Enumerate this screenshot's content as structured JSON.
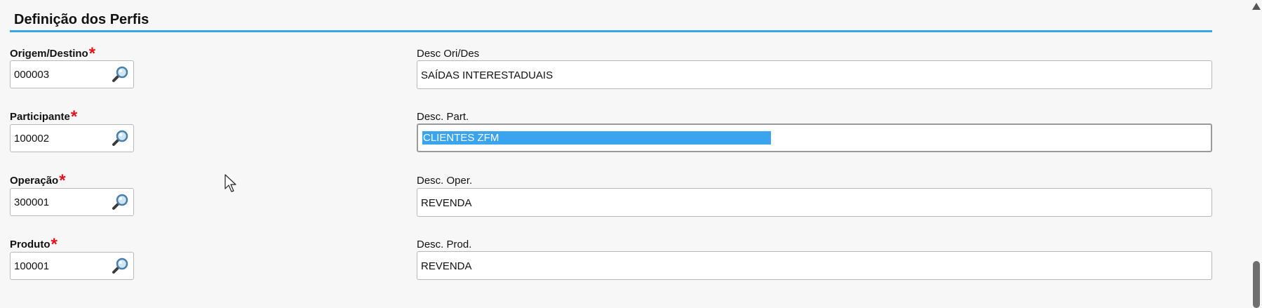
{
  "section": {
    "title": "Definição dos Perfis"
  },
  "required_marker": "*",
  "fields": [
    {
      "code_label": "Origem/Destino",
      "code_value": "000003",
      "desc_label": "Desc Ori/Des",
      "desc_value": "SAÍDAS INTERESTADUAIS"
    },
    {
      "code_label": "Participante",
      "code_value": "100002",
      "desc_label": "Desc. Part.",
      "desc_value": "CLIENTES ZFM",
      "desc_selected": true
    },
    {
      "code_label": "Operação",
      "code_value": "300001",
      "desc_label": "Desc. Oper.",
      "desc_value": "REVENDA"
    },
    {
      "code_label": "Produto",
      "code_value": "100001",
      "desc_label": "Desc. Prod.",
      "desc_value": "REVENDA"
    }
  ],
  "icons": {
    "lookup": "magnifier-icon",
    "scroll_up": "arrow-up-icon",
    "cursor": "mouse-pointer-icon"
  },
  "colors": {
    "accent_rule": "#35a6e8",
    "required": "#e0121a",
    "selection": "#3aa4ee"
  }
}
